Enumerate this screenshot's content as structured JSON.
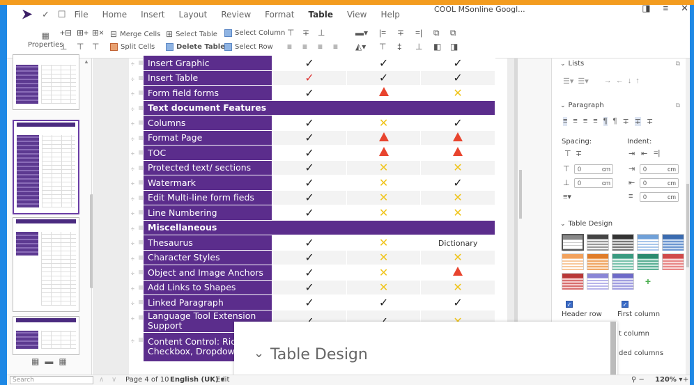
{
  "menubar": {
    "items": [
      "File",
      "Home",
      "Insert",
      "Layout",
      "Review",
      "Format",
      "Table",
      "View",
      "Help"
    ],
    "active": "Table",
    "doc_title": "COOL MSonline Googl..."
  },
  "ribbon": {
    "properties_label": "Properties",
    "merge_cells": "Merge Cells",
    "split_cells": "Split Cells",
    "select_table": "Select Table",
    "delete_table": "Delete Table",
    "select_column": "Select Column",
    "select_row": "Select Row"
  },
  "table": {
    "rows": [
      {
        "type": "row",
        "label": "Insert Graphic",
        "v": [
          "check",
          "check",
          "check"
        ]
      },
      {
        "type": "row",
        "label": "Insert Table",
        "v": [
          "check-red",
          "check",
          "check"
        ]
      },
      {
        "type": "row",
        "label": "Form field forms",
        "v": [
          "check",
          "warn",
          "x"
        ]
      },
      {
        "type": "section",
        "label": "Text document Features"
      },
      {
        "type": "row",
        "label": "Columns",
        "v": [
          "check",
          "x",
          "check"
        ]
      },
      {
        "type": "row",
        "label": "Format Page",
        "v": [
          "check",
          "warn",
          "warn"
        ]
      },
      {
        "type": "row",
        "label": "TOC",
        "v": [
          "check",
          "warn",
          "warn"
        ]
      },
      {
        "type": "row",
        "label": "Protected text/ sections",
        "v": [
          "check",
          "x",
          "x"
        ]
      },
      {
        "type": "row",
        "label": "Watermark",
        "v": [
          "check",
          "x",
          "check"
        ]
      },
      {
        "type": "row",
        "label": "Edit Multi-line form fieds",
        "v": [
          "check",
          "x",
          "x"
        ]
      },
      {
        "type": "row",
        "label": "Line Numbering",
        "v": [
          "check",
          "x",
          "x"
        ]
      },
      {
        "type": "section",
        "label": "Miscellaneous"
      },
      {
        "type": "row",
        "label": "Thesaurus",
        "v": [
          "check",
          "x",
          "Dictionary"
        ]
      },
      {
        "type": "row",
        "label": "Character Styles",
        "v": [
          "check",
          "x",
          "x"
        ]
      },
      {
        "type": "row",
        "label": "Object and Image Anchors",
        "v": [
          "check",
          "x",
          "warn"
        ]
      },
      {
        "type": "row",
        "label": "Add Links to Shapes",
        "v": [
          "check",
          "x",
          "x"
        ]
      },
      {
        "type": "row",
        "label": "Linked Paragraph",
        "v": [
          "check",
          "check",
          "check"
        ]
      },
      {
        "type": "row",
        "label": "Language Tool Extension Support",
        "v": [
          "check",
          "check",
          "x"
        ]
      },
      {
        "type": "row",
        "label": "Content Control: Rich T Checkbox, Dropdown, Date",
        "v": [
          "",
          "",
          ""
        ]
      }
    ]
  },
  "sidebar": {
    "lists_title": "Lists",
    "paragraph_title": "Paragraph",
    "spacing_label": "Spacing:",
    "indent_label": "Indent:",
    "spin_value": "0",
    "spin_unit": "cm",
    "table_design_title": "Table Design",
    "header_row": "Header row",
    "first_column": "First column",
    "column_partial": "t column",
    "banded_partial": "ded columns",
    "add_symbol": "+"
  },
  "zoom_overlay": {
    "title": "Table Design"
  },
  "status": {
    "search_placeholder": "Search",
    "page": "Page 4 of 10",
    "lang": "English (UK) ▾",
    "edit": "Edit",
    "zoom": "120% ▾"
  }
}
